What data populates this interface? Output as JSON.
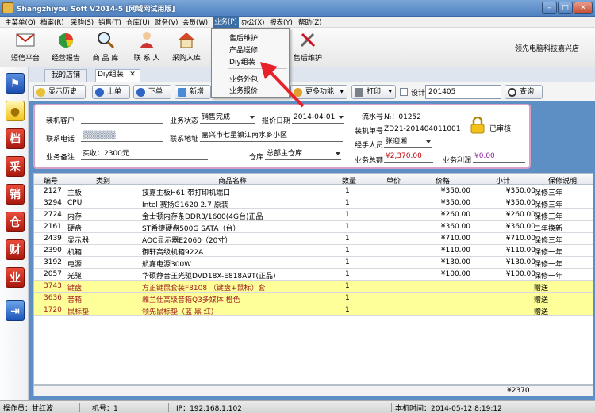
{
  "window": {
    "title": "Shangzhiyou Soft V2014-5 [网域网试用版]",
    "colors": {
      "titlebar": "#5b8ccb",
      "accent": "#3a6ea5",
      "arrow": "#e8202a",
      "highlight_row": "#ffff99"
    }
  },
  "menu": {
    "items": [
      "主菜单(Q)",
      "档案(R)",
      "采购(S)",
      "销售(T)",
      "仓库(U)",
      "财务(V)",
      "会员(W)",
      "业务(P)",
      "办公(X)",
      "报表(Y)",
      "帮助(Z)"
    ],
    "dropdown": [
      "售后维护",
      "产品送修",
      "Diy组装",
      "业务外包",
      "业务报价"
    ]
  },
  "toolbar": {
    "items": [
      "短信平台",
      "经营报告",
      "商 品 库",
      "联 系 人",
      "采购入库",
      "售后维护"
    ],
    "brand": "领先电脑科技嘉兴店"
  },
  "left_icons": [
    "flag-icon",
    "bulb-icon",
    "档",
    "采",
    "销",
    "仓",
    "财",
    "业",
    "exit-icon"
  ],
  "tabs": [
    "我的店铺",
    "Diy组装"
  ],
  "subtoolbar": {
    "history": "显示历史",
    "prev": "上单",
    "next": "下单",
    "new": "新增",
    "more": "更多功能",
    "print": "打印",
    "design": "设计",
    "search_value": "201405",
    "query": "查询"
  },
  "form": {
    "customer_label": "装机客户",
    "customer_value": "",
    "status_label": "业务状态",
    "status_value": "销售完成",
    "quote_date_label": "报价日期",
    "quote_date_value": "2014-04-01",
    "serial_label": "流水号",
    "serial_value": "№：01252",
    "phone_label": "联系电话",
    "address_label": "联系地址",
    "address_value": "嘉兴市七星镇江南水乡小区",
    "order_label": "装机单号",
    "order_value": "ZD21-201404011001",
    "audited": "已审核",
    "handler_label": "经手人员",
    "handler_value": "张迎湘",
    "remark_label": "业务备注",
    "remark_value": "实收：2300元",
    "warehouse_label": "仓库",
    "warehouse_value": "总部主仓库",
    "total_label": "业务总额",
    "total_value": "¥2,370.00",
    "profit_label": "业务利润",
    "profit_value": "¥0.00"
  },
  "table": {
    "headers": [
      "编号",
      "类别",
      "商品名称",
      "数量",
      "单价",
      "价格",
      "小计",
      "保修说明"
    ],
    "rows": [
      {
        "code": "2127",
        "cat": "主板",
        "name": "技嘉主板H61 带打印机端口",
        "qty": "1",
        "price": "¥350.00",
        "sub": "¥350.00",
        "warranty": "保修三年",
        "hl": false
      },
      {
        "code": "3294",
        "cat": "CPU",
        "name": "Intel 赛扬G1620 2.7 原装",
        "qty": "1",
        "price": "¥350.00",
        "sub": "¥350.00",
        "warranty": "保修三年",
        "hl": false
      },
      {
        "code": "2724",
        "cat": "内存",
        "name": "金士顿内存条DDR3/1600(4G台)正品",
        "qty": "1",
        "price": "¥260.00",
        "sub": "¥260.00",
        "warranty": "保修三年",
        "hl": false
      },
      {
        "code": "2161",
        "cat": "硬盘",
        "name": "ST希捷硬盘500G SATA（台）",
        "qty": "1",
        "price": "¥360.00",
        "sub": "¥360.00",
        "warranty": "二年换新",
        "hl": false
      },
      {
        "code": "2439",
        "cat": "显示器",
        "name": "AOC显示器E2060（20寸）",
        "qty": "1",
        "price": "¥710.00",
        "sub": "¥710.00",
        "warranty": "保修三年",
        "hl": false
      },
      {
        "code": "2390",
        "cat": "机箱",
        "name": "御轩高级机箱922A",
        "qty": "1",
        "price": "¥110.00",
        "sub": "¥110.00",
        "warranty": "保修一年",
        "hl": false
      },
      {
        "code": "3192",
        "cat": "电源",
        "name": "航嘉电源300W",
        "qty": "1",
        "price": "¥130.00",
        "sub": "¥130.00",
        "warranty": "保修一年",
        "hl": false
      },
      {
        "code": "2057",
        "cat": "光驱",
        "name": "华硕静音王光驱DVD18X-E818A9T(正品)",
        "qty": "1",
        "price": "¥100.00",
        "sub": "¥100.00",
        "warranty": "保修一年",
        "hl": false
      },
      {
        "code": "3743",
        "cat": "键盘",
        "name": "方正键鼠套装F8108 （键盘+鼠标）套",
        "qty": "1",
        "price": "",
        "sub": "",
        "warranty": "赠送",
        "hl": true
      },
      {
        "code": "3636",
        "cat": "音箱",
        "name": "雅兰仕高级音箱Q3多媒体 橙色",
        "qty": "1",
        "price": "",
        "sub": "",
        "warranty": "赠送",
        "hl": true
      },
      {
        "code": "1720",
        "cat": "鼠标垫",
        "name": "领先鼠标垫（蓝 黑 红）",
        "qty": "1",
        "price": "",
        "sub": "",
        "warranty": "赠送",
        "hl": true
      }
    ],
    "total": "¥2370"
  },
  "status": {
    "operator": "操作员：甘红波",
    "machine": "机号：1",
    "ip": "IP：192.168.1.102",
    "time": "本机时间：2014-05-12 8:19:12"
  }
}
